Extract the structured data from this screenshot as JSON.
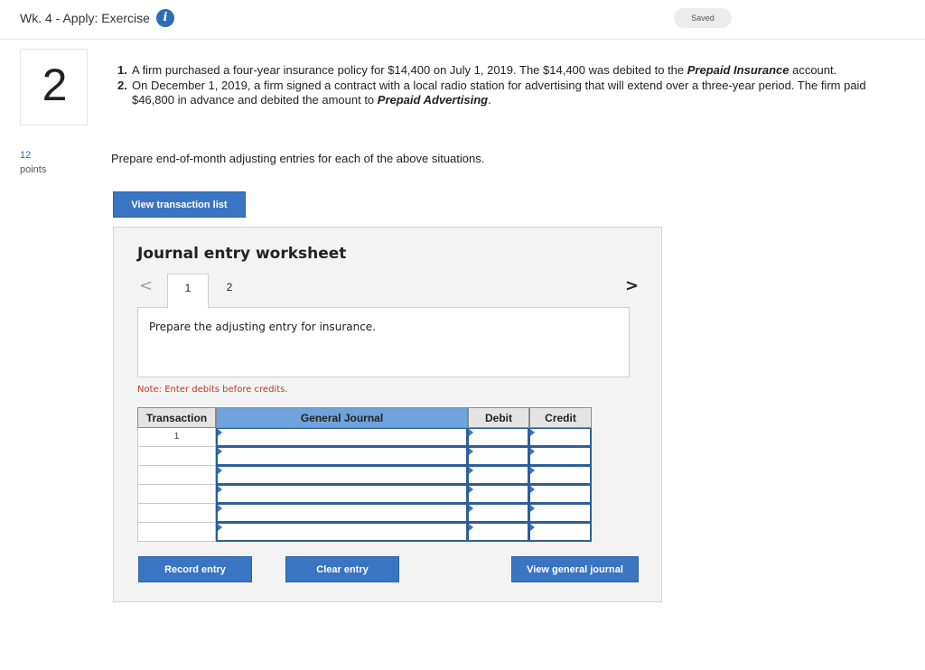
{
  "header": {
    "title": "Wk. 4 - Apply: Exercise",
    "info_icon": "i",
    "status": "Saved"
  },
  "question": {
    "number": "2",
    "points_value": "12",
    "points_label": "points",
    "problems": [
      {
        "num": "1.",
        "text_before": "A firm purchased a four-year insurance policy for $14,400 on July 1, 2019. The $14,400 was debited to the ",
        "emphasis": "Prepaid Insurance",
        "text_after": " account."
      },
      {
        "num": "2.",
        "text_before": "On December 1, 2019, a firm signed a contract with a local radio station for advertising that will extend over a three-year period. The firm paid $46,800 in advance and debited the amount to ",
        "emphasis": "Prepaid Advertising",
        "text_after": "."
      }
    ],
    "instruction": "Prepare end-of-month adjusting entries for each of the above situations."
  },
  "buttons": {
    "view_transaction_list": "View transaction list",
    "record_entry": "Record entry",
    "clear_entry": "Clear entry",
    "view_general_journal": "View general journal"
  },
  "worksheet": {
    "title": "Journal entry worksheet",
    "prev_icon": "<",
    "next_icon": ">",
    "tabs": [
      "1",
      "2"
    ],
    "active_tab": "1",
    "prompt": "Prepare the adjusting entry for insurance.",
    "note": "Note: Enter debits before credits.",
    "columns": [
      "Transaction",
      "General Journal",
      "Debit",
      "Credit"
    ],
    "rows": [
      {
        "transaction": "1",
        "general_journal": "",
        "debit": "",
        "credit": ""
      },
      {
        "transaction": "",
        "general_journal": "",
        "debit": "",
        "credit": ""
      },
      {
        "transaction": "",
        "general_journal": "",
        "debit": "",
        "credit": ""
      },
      {
        "transaction": "",
        "general_journal": "",
        "debit": "",
        "credit": ""
      },
      {
        "transaction": "",
        "general_journal": "",
        "debit": "",
        "credit": ""
      },
      {
        "transaction": "",
        "general_journal": "",
        "debit": "",
        "credit": ""
      }
    ]
  },
  "colors": {
    "accent": "#3a75c4",
    "header_cell_blue": "#6fa3db",
    "note_red": "#c0392b"
  }
}
